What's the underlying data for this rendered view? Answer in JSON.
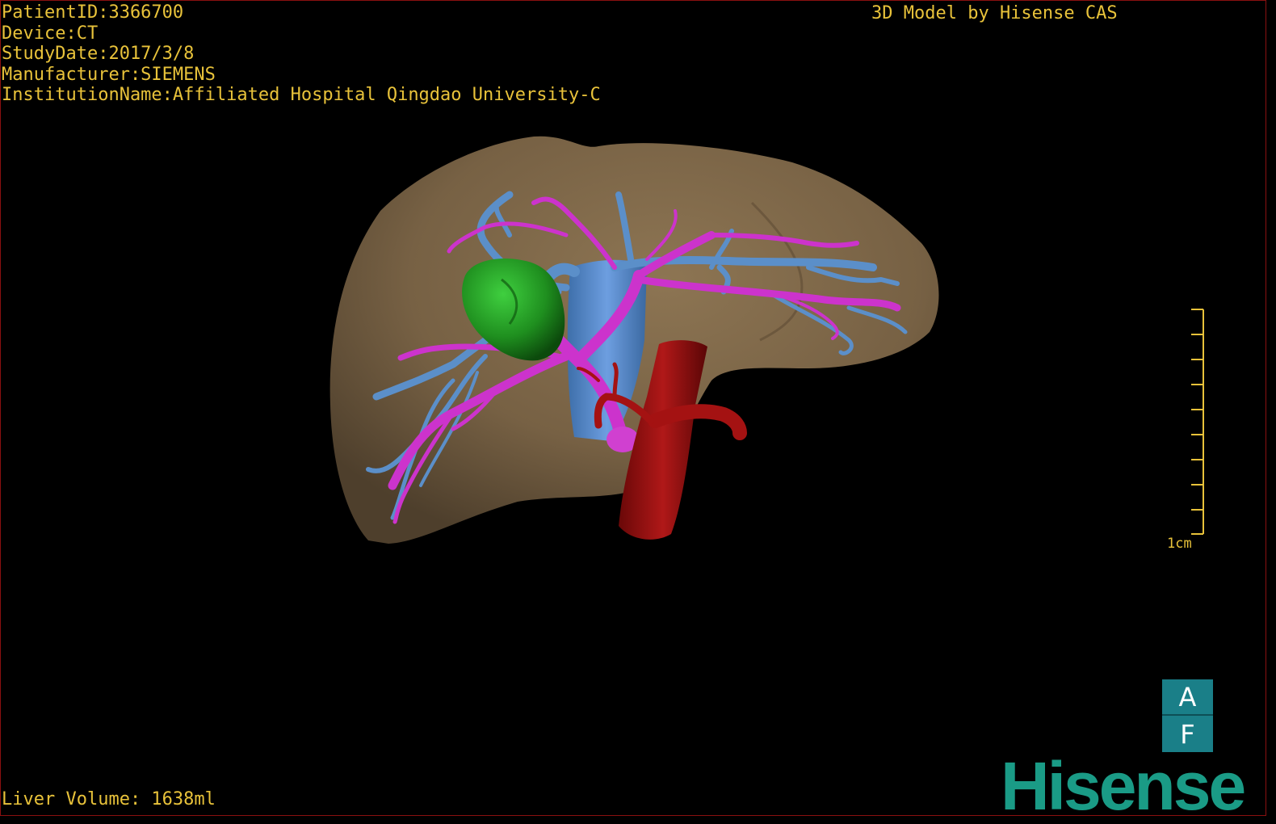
{
  "header": {
    "patient_id": "PatientID:3366700",
    "device": "Device:CT",
    "study_date": "StudyDate:2017/3/8",
    "manufacturer": "Manufacturer:SIEMENS",
    "institution": "InstitutionName:Affiliated Hospital Qingdao University-C",
    "model_by": "3D Model by Hisense CAS"
  },
  "footer": {
    "liver_volume": "Liver Volume: 1638ml"
  },
  "scale_bar": {
    "label": "1cm"
  },
  "orientation_cube": {
    "top": "A",
    "bottom": "F"
  },
  "brand": {
    "logo_text": "Hisense"
  },
  "colors": {
    "overlay_text": "#e8c23a",
    "liver": "#7a6447",
    "portal_vein": "#cc33cc",
    "hepatic_vein": "#5b8fc9",
    "tumor": "#1e8a1e",
    "aorta": "#9c1010",
    "ivc": "#4f83c8",
    "logo": "#1a9b86"
  }
}
